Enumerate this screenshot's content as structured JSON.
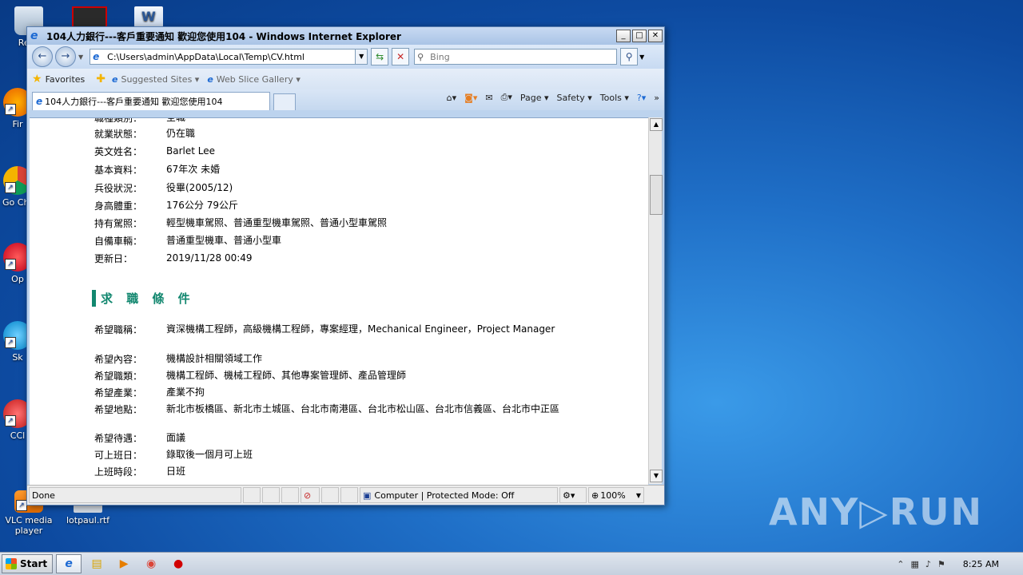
{
  "desktop": {
    "icons": [
      {
        "label": "Recy"
      },
      {
        "label": "Fir"
      },
      {
        "label": "Go Chr"
      },
      {
        "label": "Op"
      },
      {
        "label": "Sk"
      },
      {
        "label": "CCl"
      },
      {
        "label": "VLC media player"
      },
      {
        "label": "lotpaul.rtf"
      }
    ],
    "watermark": "ANY▷RUN"
  },
  "window": {
    "title": "104人力銀行---客戶重要通知 歡迎您使用104 - Windows Internet Explorer",
    "address": "C:\\Users\\admin\\AppData\\Local\\Temp\\CV.html",
    "search_placeholder": "Bing",
    "favorites_label": "Favorites",
    "suggested_sites": "Suggested Sites ▾",
    "web_slice": "Web Slice Gallery ▾",
    "tab_title": "104人力銀行---客戶重要通知 歡迎您使用104",
    "commands": {
      "page": "Page ▾",
      "safety": "Safety ▾",
      "tools": "Tools ▾"
    }
  },
  "content": {
    "partial_row": {
      "label": "職種類別：",
      "value": "全職"
    },
    "profile_rows": [
      {
        "label": "就業狀態：",
        "value": "仍在職"
      },
      {
        "label": "英文姓名：",
        "value": "Barlet Lee"
      },
      {
        "label": "基本資料：",
        "value": "67年次  未婚"
      },
      {
        "label": "兵役狀況：",
        "value": "役畢(2005/12)"
      },
      {
        "label": "身高體重：",
        "value": "176公分  79公斤"
      },
      {
        "label": "持有駕照：",
        "value": "輕型機車駕照、普通重型機車駕照、普通小型車駕照"
      },
      {
        "label": "自備車輛：",
        "value": "普通重型機車、普通小型車"
      },
      {
        "label": "更新日：",
        "value": "2019/11/28 00:49"
      }
    ],
    "section_title": "求 職 條 件",
    "job_rows": [
      {
        "label": "希望職稱：",
        "value": "資深機構工程師，高級機構工程師，專案經理，Mechanical Engineer，Project Manager"
      },
      {
        "label": "希望內容：",
        "value": "機構設計相關領域工作"
      },
      {
        "label": "希望職類：",
        "value": "機構工程師、機械工程師、其他專案管理師、產品管理師"
      },
      {
        "label": "希望產業：",
        "value": "產業不拘"
      },
      {
        "label": "希望地點：",
        "value": "新北市板橋區、新北市土城區、台北市南港區、台北市松山區、台北市信義區、台北市中正區"
      },
      {
        "label": "希望待遇：",
        "value": "面議"
      },
      {
        "label": "可上班日：",
        "value": "錄取後一個月可上班"
      },
      {
        "label": "上班時段：",
        "value": "日班"
      }
    ]
  },
  "status": {
    "text": "Done",
    "zone": "Computer | Protected Mode: Off",
    "zoom": "100%"
  },
  "taskbar": {
    "start": "Start",
    "clock": "8:25 AM"
  }
}
